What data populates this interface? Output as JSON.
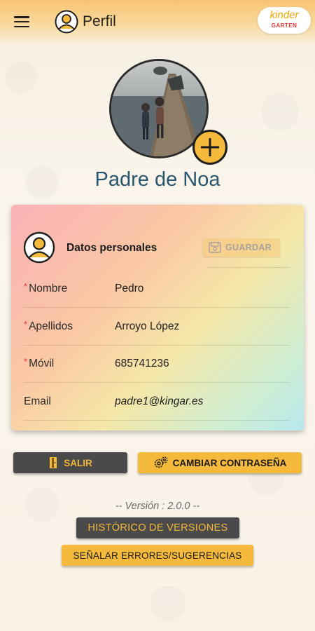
{
  "header": {
    "title": "Perfil",
    "logo_line1": "kinder",
    "logo_line2": "GARTEN",
    "menu_icon": "hamburger-icon",
    "avatar_icon": "user-avatar-icon"
  },
  "profile": {
    "name": "Padre de Noa",
    "add_photo_icon": "plus-icon"
  },
  "card": {
    "title": "Datos personales",
    "save_label": "GUARDAR",
    "fields": [
      {
        "label": "Nombre",
        "required": true,
        "value": "Pedro"
      },
      {
        "label": "Apellidos",
        "required": true,
        "value": "Arroyo López"
      },
      {
        "label": "Móvil",
        "required": true,
        "value": "685741236"
      },
      {
        "label": "Email",
        "required": false,
        "value": "padre1@kingar.es"
      }
    ],
    "required_marker": "*"
  },
  "actions": {
    "logout_label": "SALIR",
    "change_password_label": "CAMBIAR CONTRASEÑA"
  },
  "footer": {
    "version_text": "-- Versión : 2.0.0 --",
    "history_label": "HISTÓRICO DE VERSIONES",
    "report_label": "SEÑALAR ERRORES/SUGERENCIAS"
  },
  "colors": {
    "accent": "#f5b93b",
    "dark_button": "#4a4a4a",
    "name_color": "#27566e",
    "required": "#e53935"
  }
}
